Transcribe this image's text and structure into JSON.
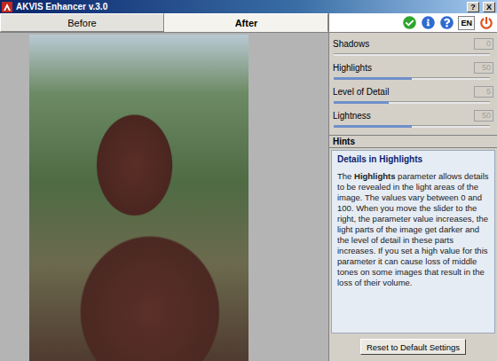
{
  "window": {
    "title": "AKVIS Enhancer v.3.0",
    "controls": [
      "?",
      "X"
    ]
  },
  "tabs": [
    {
      "label": "Before",
      "selected": false
    },
    {
      "label": "After",
      "selected": true
    }
  ],
  "toolbar": {
    "language": "EN"
  },
  "sliders": [
    {
      "label": "Shadows",
      "value": "0",
      "level": 0,
      "disabled": true
    },
    {
      "label": "Highlights",
      "value": "50",
      "level": 0.5,
      "disabled": true
    },
    {
      "label": "Level of Detail",
      "value": "5",
      "level": 0.35,
      "disabled": true
    },
    {
      "label": "Lightness",
      "value": "50",
      "level": 0.5,
      "disabled": true
    }
  ],
  "hints": {
    "header": "Hints",
    "title": "Details in Highlights",
    "body": [
      {
        "text": "The ",
        "bold": false
      },
      {
        "text": "Highlights",
        "bold": true
      },
      {
        "text": " parameter allows details to be revealed in the light areas of the image. The values vary between 0 and 100. When you move the slider to the right, the parameter value increases, the light parts of the image get darker and the level of detail in these parts increases. If you set a high value for this parameter it can cause loss of middle tones on some images that result in the loss of their volume.",
        "bold": false
      }
    ]
  },
  "buttons": [
    "Reset to Default Settings"
  ]
}
